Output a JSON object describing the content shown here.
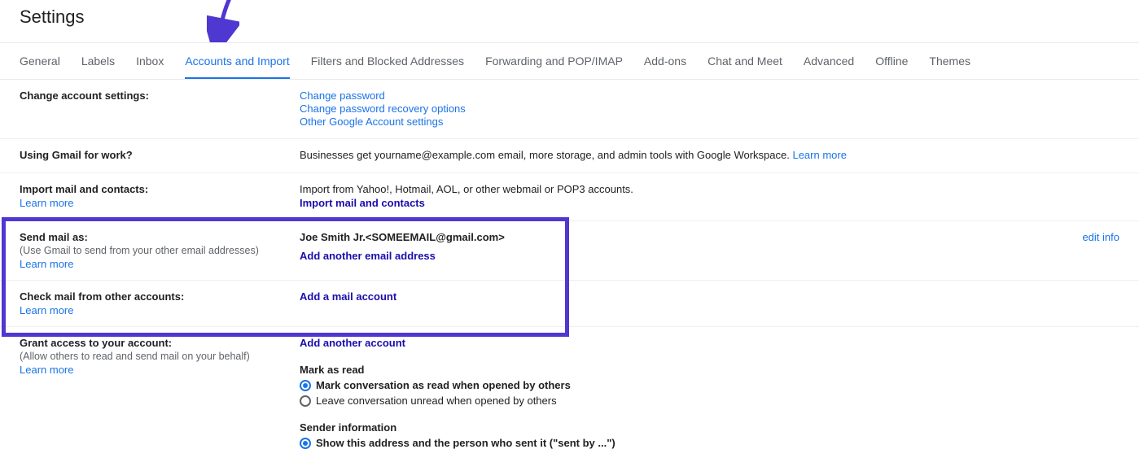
{
  "pageTitle": "Settings",
  "tabs": [
    {
      "label": "General",
      "active": false
    },
    {
      "label": "Labels",
      "active": false
    },
    {
      "label": "Inbox",
      "active": false
    },
    {
      "label": "Accounts and Import",
      "active": true
    },
    {
      "label": "Filters and Blocked Addresses",
      "active": false
    },
    {
      "label": "Forwarding and POP/IMAP",
      "active": false
    },
    {
      "label": "Add-ons",
      "active": false
    },
    {
      "label": "Chat and Meet",
      "active": false
    },
    {
      "label": "Advanced",
      "active": false
    },
    {
      "label": "Offline",
      "active": false
    },
    {
      "label": "Themes",
      "active": false
    }
  ],
  "changeAccount": {
    "title": "Change account settings:",
    "links": [
      "Change password",
      "Change password recovery options",
      "Other Google Account settings"
    ]
  },
  "workGmail": {
    "title": "Using Gmail for work?",
    "text": "Businesses get yourname@example.com email, more storage, and admin tools with Google Workspace. ",
    "learn": "Learn more"
  },
  "importMail": {
    "title": "Import mail and contacts:",
    "learn": "Learn more",
    "desc": "Import from Yahoo!, Hotmail, AOL, or other webmail or POP3 accounts.",
    "action": "Import mail and contacts"
  },
  "sendAs": {
    "title": "Send mail as:",
    "sub": "(Use Gmail to send from your other email addresses)",
    "learn": "Learn more",
    "identity": "Joe Smith Jr.<SOMEEMAIL@gmail.com>",
    "add": "Add another email address",
    "edit": "edit info"
  },
  "checkMail": {
    "title": "Check mail from other accounts:",
    "learn": "Learn more",
    "add": "Add a mail account"
  },
  "grant": {
    "title": "Grant access to your account:",
    "sub": "(Allow others to read and send mail on your behalf)",
    "learn": "Learn more",
    "add": "Add another account",
    "markHead": "Mark as read",
    "mark1": "Mark conversation as read when opened by others",
    "mark2": "Leave conversation unread when opened by others",
    "senderHead": "Sender information",
    "sender1": "Show this address and the person who sent it (\"sent by ...\")"
  },
  "annotation": {
    "highlightColor": "#4f37d1",
    "arrowColor": "#4f37d1"
  }
}
